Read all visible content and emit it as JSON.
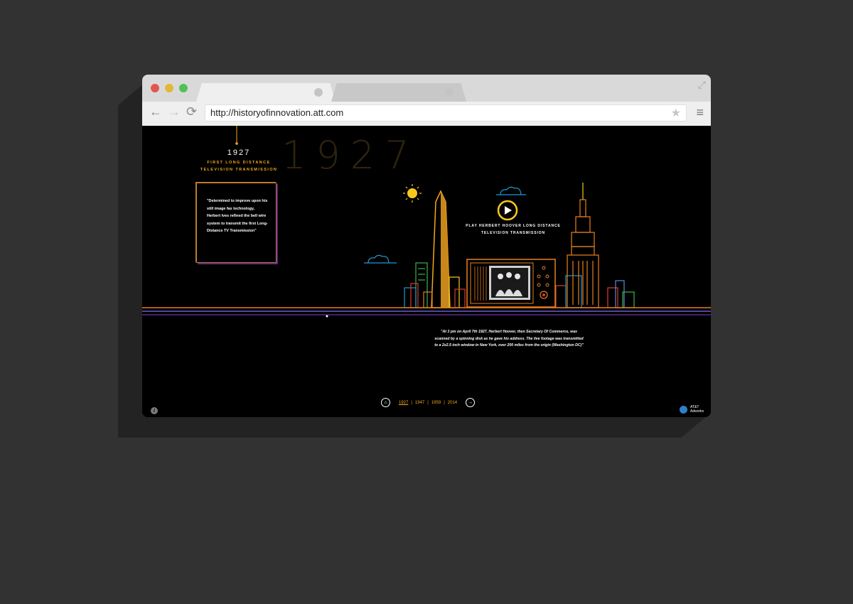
{
  "browser": {
    "url": "http://historyofinnovation.att.com",
    "nav_back": "←",
    "nav_forward": "→",
    "nav_reload": "⟳",
    "star": "★",
    "menu": "≡",
    "expand": "⤢"
  },
  "page": {
    "big_year": "1927",
    "year": "1927",
    "subtitle_line1": "FIRST LONG DISTANCE",
    "subtitle_line2": "TELEVISION TRANSMISSION",
    "quote": "\"Determined to improve upon his still image fax technology, Herbert Ives refined the bell wire system to transmit the first Long-Distance TV Transmission\"",
    "play_label_line1": "PLAY HERBERT HOOVER LONG DISTANCE",
    "play_label_line2": "TELEVISION TRANSMISSION",
    "caption": "\"At 3 pm on April 7th 1927, Herbert Hoover, then Secretary Of Commerce, was scanned by a spinning disk as he gave his address. The live footage was transmitted to a 2x2.5 inch window in New York, over 200 miles from the origin (Washington DC)\""
  },
  "timeline": {
    "years": [
      "1927",
      "1947",
      "1959",
      "2014"
    ],
    "active": "1927",
    "separator": "|",
    "home_icon": "home-icon",
    "next_icon": "arrow-right-icon"
  },
  "footer": {
    "info_icon": "i",
    "logo_line1": "AT&T",
    "logo_line2": "Adworks"
  },
  "colors": {
    "accent": "#f4a81d",
    "orange": "#e8801f",
    "blue": "#1d9ad6",
    "purple": "#5b2a8a",
    "green": "#3bb54a",
    "red": "#e03a2f"
  }
}
